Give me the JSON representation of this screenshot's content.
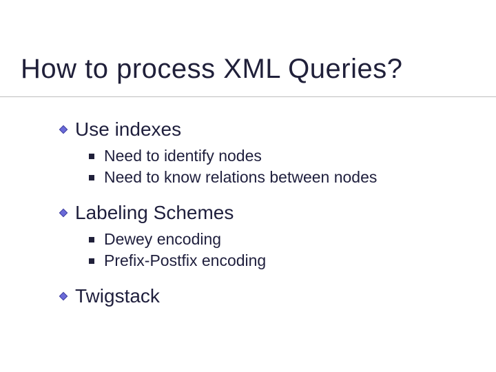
{
  "title": "How to process XML Queries?",
  "items": {
    "a": {
      "label": "Use indexes",
      "children": {
        "a": "Need to identify nodes",
        "b": "Need to know relations between nodes"
      }
    },
    "b": {
      "label": "Labeling Schemes",
      "children": {
        "a": "Dewey encoding",
        "b": "Prefix-Postfix encoding"
      }
    },
    "c": {
      "label": "Twigstack"
    }
  }
}
